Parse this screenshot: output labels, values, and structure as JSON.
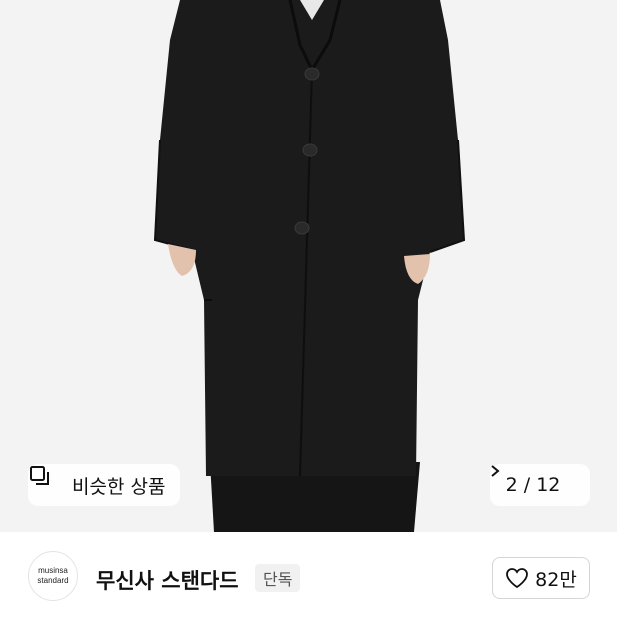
{
  "gallery": {
    "image_alt": "Black long wool coat product photo",
    "similar_label": "비슷한 상품",
    "counter_text": "2 / 12"
  },
  "brand": {
    "logo_line1": "musinsa",
    "logo_line2": "standard",
    "name": "무신사 스탠다드",
    "tag": "단독"
  },
  "like": {
    "count": "82만"
  },
  "icons": [
    "similar-items-icon",
    "chevron-right-icon",
    "heart-icon"
  ]
}
